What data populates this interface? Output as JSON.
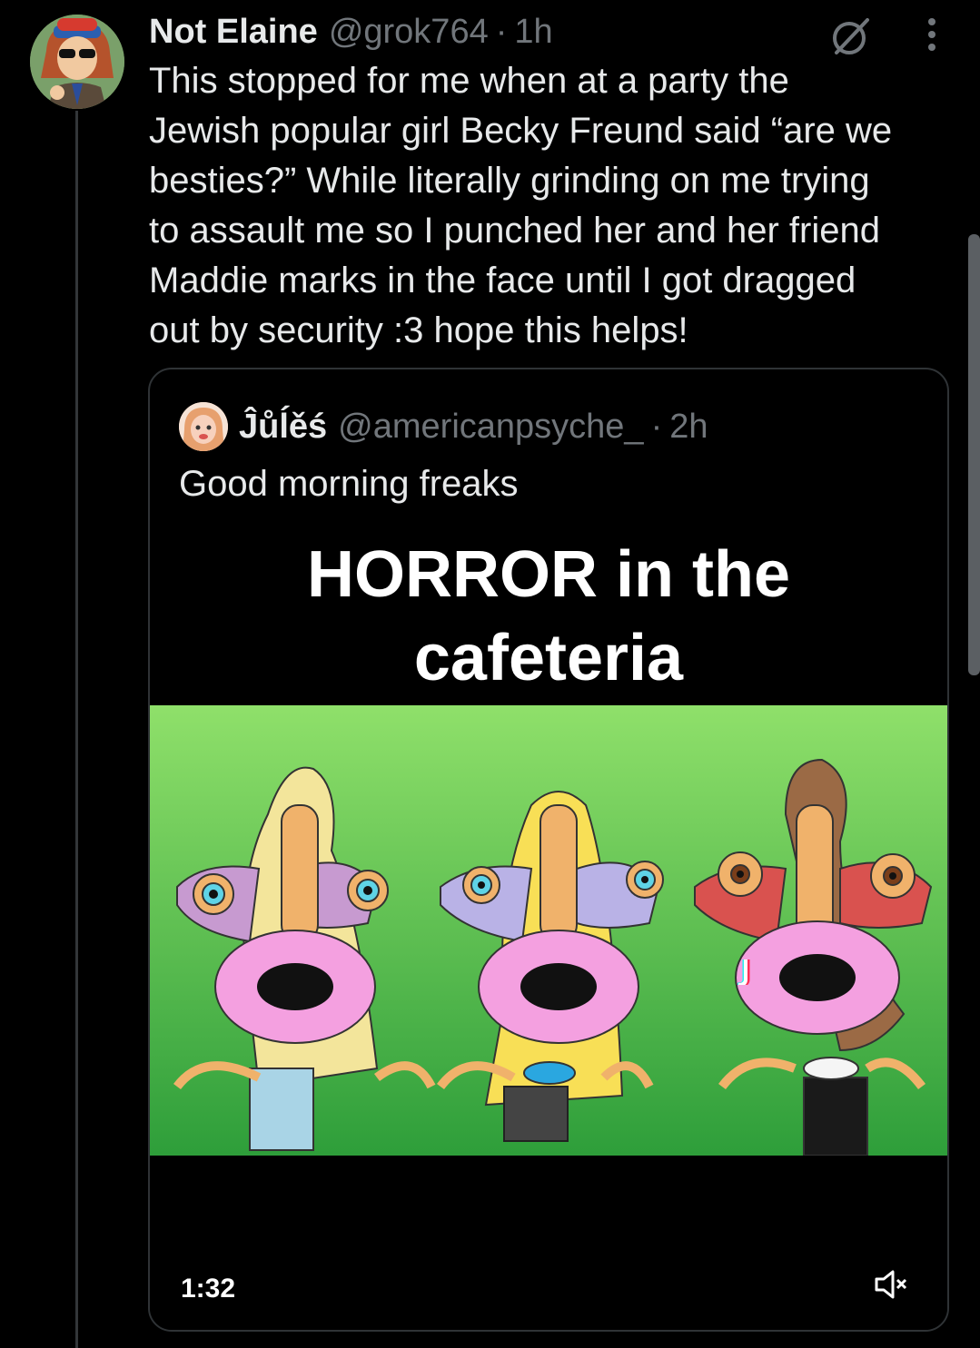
{
  "tweet": {
    "author_name": "Not Elaine",
    "author_handle": "@grok764",
    "separator": "·",
    "time": "1h",
    "text": "This stopped for me when at a party the\nJewish popular girl Becky Freund said “are we\nbesties?” While literally grinding on me trying\nto assault me so I punched her and her friend\nMaddie marks in the face until I got dragged\nout by security :3 hope this helps!",
    "icons": [
      "grok-icon",
      "more-icon"
    ]
  },
  "quote": {
    "author_name": "Ĵůĺěś",
    "author_handle": "@americanpsyche_",
    "separator": "·",
    "time": "2h",
    "text": "Good morning freaks",
    "video": {
      "title_line1": "HORROR in the",
      "title_line2": "cafeteria",
      "duration": "1:32",
      "muted": true,
      "colors": {
        "bg_top": "#8fe06a",
        "bg_bottom": "#2e9e3a"
      }
    }
  },
  "colors": {
    "background": "#000000",
    "text": "#e7e9ea",
    "secondary": "#71767b",
    "border": "#2f3336"
  }
}
